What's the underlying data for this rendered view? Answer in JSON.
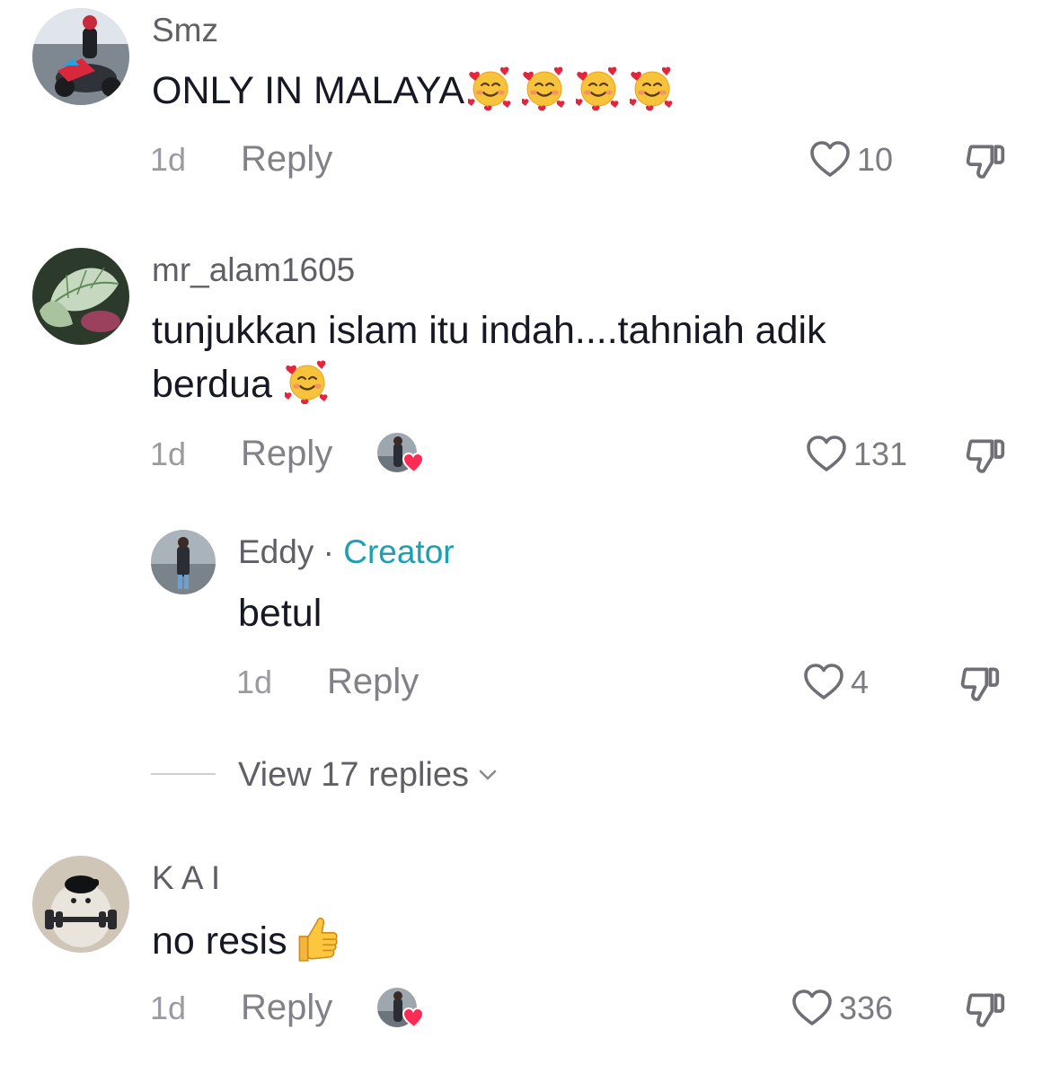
{
  "comments": [
    {
      "username": "Smz",
      "text": "ONLY IN MALAYA",
      "emoji": [
        "smiling-face-with-hearts-emoji",
        "smiling-face-with-hearts-emoji",
        "smiling-face-with-hearts-emoji",
        "smiling-face-with-hearts-emoji"
      ],
      "time": "1d",
      "reply_label": "Reply",
      "likes": "10"
    },
    {
      "username": "mr_alam1605",
      "text_line1": "tunjukkan islam itu indah....tahniah adik",
      "text_line2": "berdua",
      "emoji": [
        "smiling-face-with-hearts-emoji"
      ],
      "time": "1d",
      "reply_label": "Reply",
      "likes": "131",
      "creator_liked": true,
      "replies": [
        {
          "username": "Eddy",
          "separator": " · ",
          "badge": "Creator",
          "text": "betul",
          "time": "1d",
          "reply_label": "Reply",
          "likes": "4"
        }
      ],
      "view_replies_label": "View 17 replies"
    },
    {
      "username": "K A I",
      "text": "no resis",
      "emoji": [
        "thumbs-up-emoji"
      ],
      "time": "1d",
      "reply_label": "Reply",
      "likes": "336",
      "creator_liked": true
    }
  ],
  "colors": {
    "creator_badge": "#1c9fb0",
    "heart_fill": "#fe2c55",
    "muted_text": "#818188"
  }
}
